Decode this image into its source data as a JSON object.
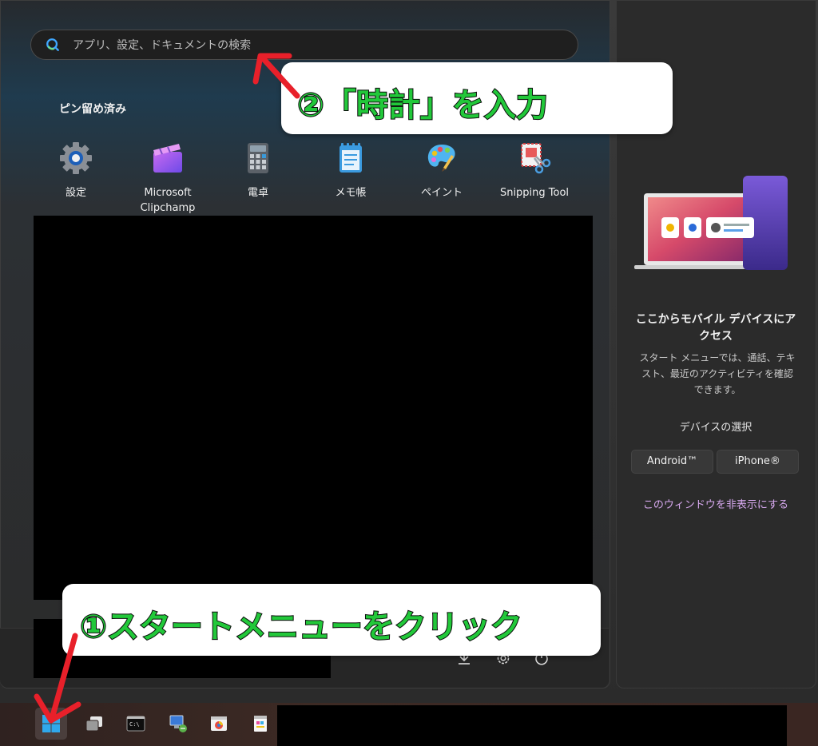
{
  "search": {
    "placeholder": "アプリ、設定、ドキュメントの検索"
  },
  "pinned": {
    "title": "ピン留め済み",
    "apps": [
      {
        "label": "設定",
        "icon": "gear-icon"
      },
      {
        "label": "Microsoft Clipchamp",
        "icon": "clipchamp-icon"
      },
      {
        "label": "電卓",
        "icon": "calculator-icon"
      },
      {
        "label": "メモ帳",
        "icon": "notepad-icon"
      },
      {
        "label": "ペイント",
        "icon": "paint-palette-icon"
      },
      {
        "label": "Snipping Tool",
        "icon": "scissors-icon"
      }
    ]
  },
  "side_panel": {
    "title": "ここからモバイル デバイスにアクセス",
    "description": "スタート メニューでは、通話、テキスト、最近のアクティビティを確認できます。",
    "select_label": "デバイスの選択",
    "android_button": "Android™",
    "iphone_button": "iPhone®",
    "hide_link": "このウィンドウを非表示にする"
  },
  "annotations": {
    "step2": "②「時計」を入力",
    "step1": "①スタートメニューをクリック"
  },
  "colors": {
    "annotation_text": "#22c83a",
    "annotation_arrow": "#e8202a",
    "link": "#d6a8ee"
  }
}
